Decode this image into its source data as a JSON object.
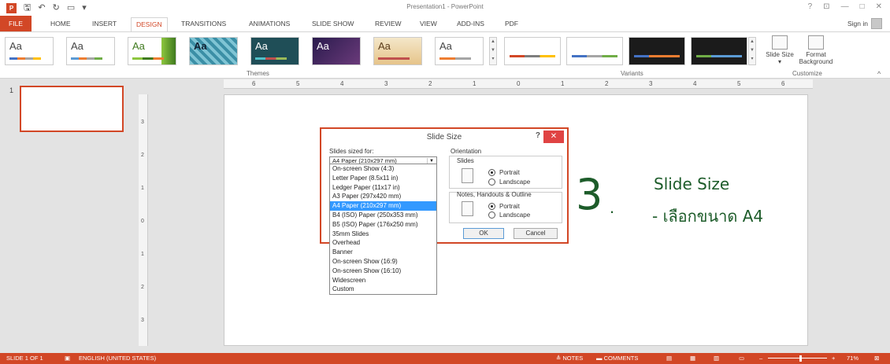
{
  "titlebar": {
    "title": "Presentation1 - PowerPoint",
    "logo": "P",
    "save_icon": "🖫",
    "undo_icon": "↶",
    "redo_icon": "↻",
    "present_icon": "▭",
    "customize_icon": "▾",
    "help": "?",
    "restore_icon": "⊡",
    "minimize": "—",
    "maximize": "□",
    "close": "✕"
  },
  "tabs": {
    "file": "FILE",
    "home": "HOME",
    "insert": "INSERT",
    "design": "DESIGN",
    "transitions": "TRANSITIONS",
    "animations": "ANIMATIONS",
    "slideshow": "SLIDE SHOW",
    "review": "REVIEW",
    "view": "VIEW",
    "addins": "ADD-INS",
    "pdf": "PDF",
    "signin": "Sign in"
  },
  "ribbon": {
    "themes_label": "Themes",
    "variants_label": "Variants",
    "customize_label": "Customize",
    "theme_aa": [
      "Aa",
      "Aa",
      "Aa",
      "Aa",
      "Aa",
      "Aa",
      "Aa",
      "Aa"
    ],
    "slide_size": "Slide Size ▾",
    "format_background": "Format Background",
    "collapse": "^"
  },
  "thumbnail": {
    "number": "1"
  },
  "ruler": {
    "h": [
      "6",
      "5",
      "4",
      "3",
      "2",
      "1",
      "0",
      "1",
      "2",
      "3",
      "4",
      "5",
      "6"
    ],
    "v": [
      "3",
      "2",
      "1",
      "0",
      "1",
      "2",
      "3"
    ]
  },
  "slide": {
    "number": "3",
    "dot": ".",
    "title": "Slide Size",
    "subtitle": "- เลือกขนาด A4"
  },
  "dialog": {
    "title": "Slide Size",
    "help": "?",
    "close": "✕",
    "sized_for_label": "Slides sized for:",
    "sized_for_value": "A4 Paper (210x297 mm)",
    "orientation_label": "Orientation",
    "slides_label": "Slides",
    "portrait": "Portrait",
    "landscape": "Landscape",
    "notes_label": "Notes, Handouts & Outline",
    "notes_portrait": "Portrait",
    "notes_landscape": "Landscape",
    "ok": "OK",
    "cancel": "Cancel",
    "options": [
      "On-screen Show (4:3)",
      "Letter Paper (8.5x11 in)",
      "Ledger Paper (11x17 in)",
      "A3 Paper (297x420 mm)",
      "A4 Paper (210x297 mm)",
      "B4 (ISO) Paper (250x353 mm)",
      "B5 (ISO) Paper (176x250 mm)",
      "35mm Slides",
      "Overhead",
      "Banner",
      "On-screen Show (16:9)",
      "On-screen Show (16:10)",
      "Widescreen",
      "Custom"
    ],
    "selected_option": "A4 Paper (210x297 mm)"
  },
  "status": {
    "slide": "SLIDE 1 OF 1",
    "language": "ENGLISH (UNITED STATES)",
    "notes": "≜ NOTES",
    "comments": "▬ COMMENTS",
    "zoom": "71%",
    "zoom_minus": "–",
    "zoom_plus": "+"
  },
  "colors": {
    "accent": "#d24726",
    "slide_text": "#1d5c2a",
    "selection": "#3399ff"
  }
}
